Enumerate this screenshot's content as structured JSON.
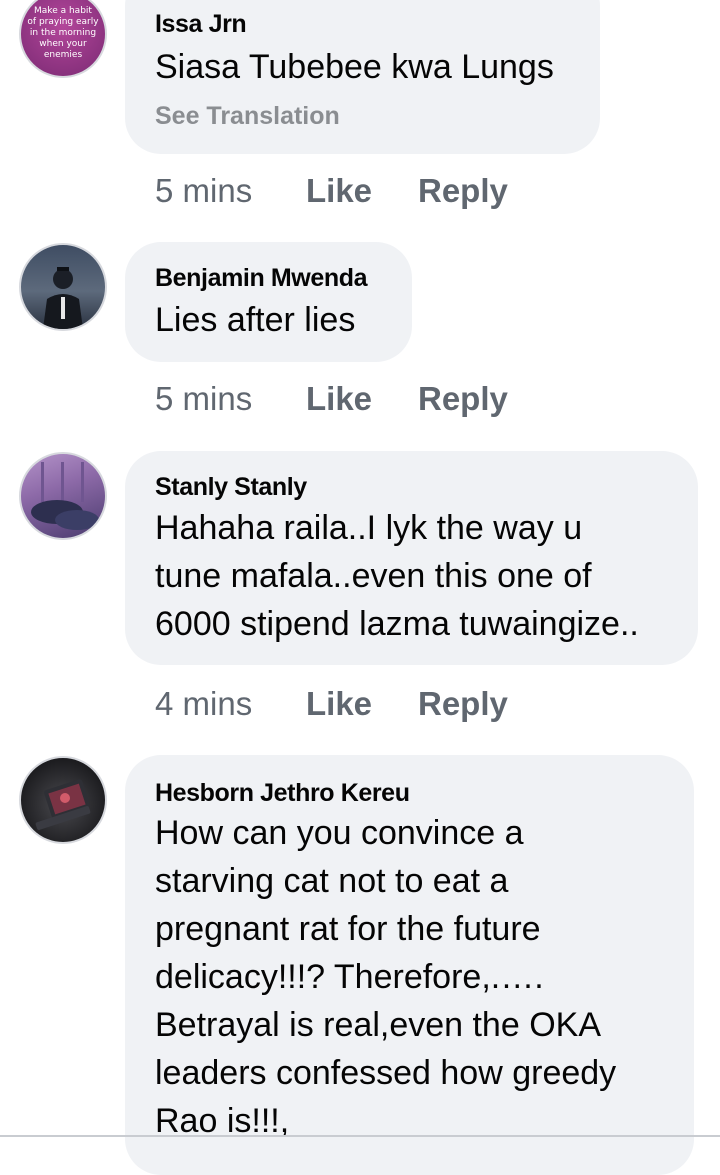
{
  "comments": [
    {
      "author": "Issa Jrn",
      "lines": [
        "Siasa Tubebee kwa Lungs"
      ],
      "translation_label": "See Translation",
      "time": "5 mins",
      "like_label": "Like",
      "reply_label": "Reply",
      "avatar_text": [
        "Make a habit",
        "of praying early",
        "in the morning",
        "when your",
        "enemies"
      ]
    },
    {
      "author": "Benjamin Mwenda",
      "lines": [
        "Lies after lies"
      ],
      "time": "5 mins",
      "like_label": "Like",
      "reply_label": "Reply"
    },
    {
      "author": "Stanly Stanly",
      "lines": [
        "Hahaha raila..I lyk the way u",
        "tune mafala..even this one of",
        "6000 stipend lazma tuwaingize.."
      ],
      "time": "4 mins",
      "like_label": "Like",
      "reply_label": "Reply"
    },
    {
      "author": "Hesborn Jethro Kereu",
      "lines": [
        "How can you convince a",
        "starving cat not to eat a",
        "pregnant rat for the future",
        "delicacy!!!? Therefore,.….",
        "Betrayal is real,even the OKA",
        "leaders confessed how greedy",
        "Rao is!!!,"
      ]
    }
  ],
  "colors": {
    "bubble": "#f0f2f5",
    "name_text": "#050505",
    "meta_text": "#606770",
    "translation_text": "#8a8d91"
  }
}
